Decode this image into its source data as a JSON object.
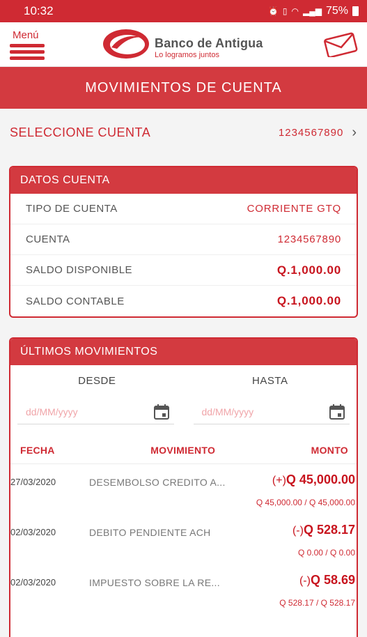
{
  "status": {
    "time": "10:32",
    "battery": "75%"
  },
  "header": {
    "menu_label": "Menú",
    "bank_name": "Banco de Antigua",
    "bank_tagline": "Lo logramos juntos"
  },
  "page_title": "MOVIMIENTOS DE CUENTA",
  "select_account": {
    "label": "SELECCIONE CUENTA",
    "value": "1234567890"
  },
  "account_data": {
    "title": "DATOS CUENTA",
    "rows": [
      {
        "label": "TIPO DE CUENTA",
        "value": "CORRIENTE GTQ"
      },
      {
        "label": "CUENTA",
        "value": "1234567890"
      },
      {
        "label": "SALDO DISPONIBLE",
        "value": "Q.1,000.00"
      },
      {
        "label": "SALDO CONTABLE",
        "value": "Q.1,000.00"
      }
    ]
  },
  "movements": {
    "title": "ÚLTIMOS MOVIMIENTOS",
    "from_label": "DESDE",
    "to_label": "HASTA",
    "from_placeholder": "dd/MM/yyyy",
    "to_placeholder": "dd/MM/yyyy",
    "columns": [
      "FECHA",
      "MOVIMIENTO",
      "MONTO"
    ],
    "items": [
      {
        "date": "27/03/2020",
        "description": "DESEMBOLSO CREDITO A...",
        "sign": "(+)",
        "amount": "Q 45,000.00",
        "balance": "Q 45,000.00 / Q 45,000.00"
      },
      {
        "date": "02/03/2020",
        "description": "DEBITO PENDIENTE ACH",
        "sign": "(-)",
        "amount": "Q 528.17",
        "balance": "Q 0.00 / Q 0.00"
      },
      {
        "date": "02/03/2020",
        "description": "IMPUESTO SOBRE LA RE...",
        "sign": "(-)",
        "amount": "Q 58.69",
        "balance": "Q 528.17 / Q 528.17"
      }
    ]
  },
  "colors": {
    "brand": "#cf2a33",
    "header_bg": "#d33a40",
    "amount": "#c8141e"
  }
}
